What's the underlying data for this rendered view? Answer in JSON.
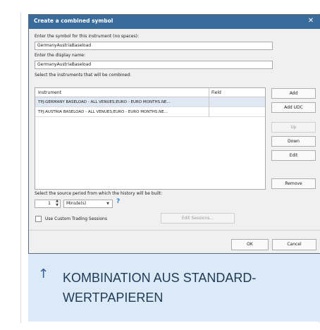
{
  "dialog": {
    "title": "Create a combined symbol",
    "close_glyph": "✕",
    "symbol_label": "Enter the symbol for this instrument (no spaces):",
    "symbol_value": "GermanyAustriaBaseload",
    "display_label": "Enter the display name:",
    "display_value": "GermanyAustriaBaseload",
    "instruments_label": "Select the instruments that will be combined:",
    "grid": {
      "columns": [
        "Instrument",
        "Field"
      ],
      "rows": [
        {
          "instrument": "TPJ:GERMANY BASELOAD - ALL VENUES;EURO - EURO MONTHS.NE...",
          "field": ""
        },
        {
          "instrument": "TPJ:AUSTRIA BASELOAD - ALL VENUES;EURO - EURO MONTHS.NE...",
          "field": ""
        }
      ]
    },
    "buttons": {
      "add": "Add",
      "add_udc": "Add UDC",
      "up": "Up",
      "down": "Down",
      "edit": "Edit",
      "remove": "Remove",
      "edit_sessions": "Edit Sessions...",
      "ok": "OK",
      "cancel": "Cancel"
    },
    "period_label": "Select the source period from which the history will be built:",
    "period_value": "1",
    "period_unit": "Minute(s)",
    "help_glyph": "?",
    "custom_sessions_label": "Use Custom Trading Sessions"
  },
  "caption": {
    "arrow_glyph": "↑",
    "text": "KOMBINATION AUS STANDARD-WERTPAPIEREN"
  },
  "colors": {
    "titlebar": "#3a6c9b",
    "caption_bg": "#dbeaf6",
    "caption_text": "#1e3a56",
    "help_icon": "#2a7fd4"
  }
}
